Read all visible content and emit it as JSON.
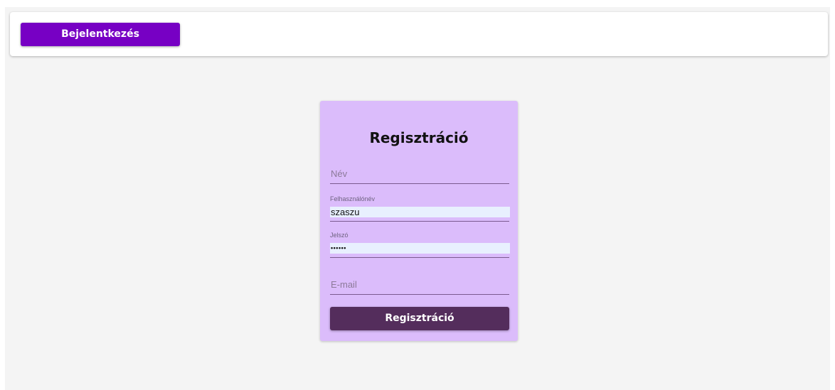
{
  "header": {
    "login_label": "Bejelentkezés"
  },
  "register_form": {
    "title": "Regisztráció",
    "name_field": {
      "placeholder": "Név",
      "value": ""
    },
    "username_field": {
      "label": "Felhasználónév",
      "value": "szaszu"
    },
    "password_field": {
      "label": "Jelszó",
      "value": "••••••"
    },
    "email_field": {
      "placeholder": "E-mail",
      "value": ""
    },
    "submit_label": "Regisztráció"
  },
  "colors": {
    "login_button": "#7700c4",
    "card_background": "#dbbcfb",
    "submit_button": "#542d5c",
    "page_background": "#f4f4f4",
    "autofill_background": "#e8f0fe"
  }
}
